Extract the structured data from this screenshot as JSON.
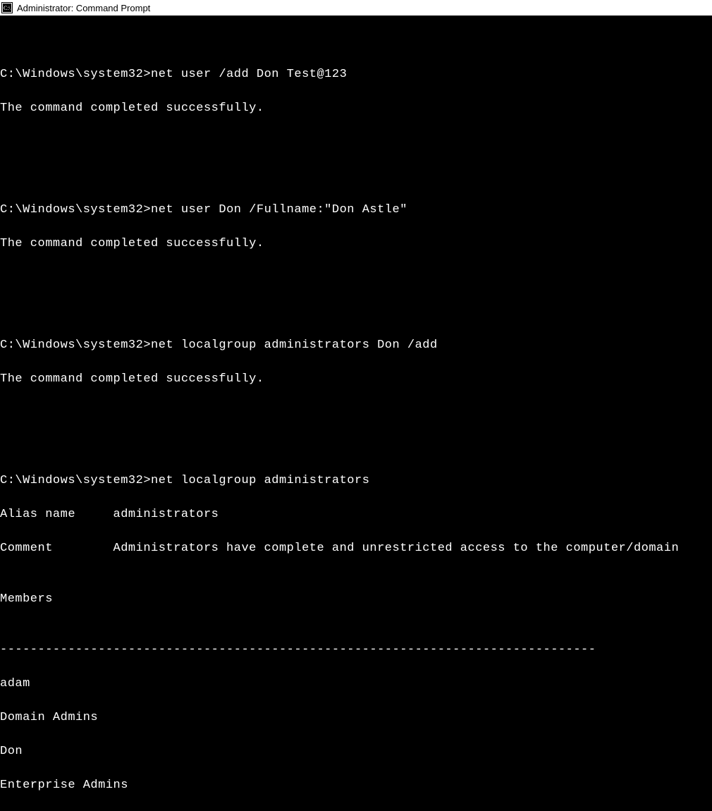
{
  "window": {
    "title": "Administrator: Command Prompt"
  },
  "prompt": "C:\\Windows\\system32>",
  "terminal": {
    "blocks": [
      {
        "cmd": "net user /add Don Test@123",
        "out": [
          "The command completed successfully."
        ]
      },
      {
        "cmd": "net user Don /Fullname:\"Don Astle\"",
        "out": [
          "The command completed successfully."
        ]
      },
      {
        "cmd": "net localgroup administrators Don /add",
        "out": [
          "The command completed successfully."
        ]
      },
      {
        "cmd": "net localgroup administrators",
        "out": [
          "Alias name     administrators",
          "Comment        Administrators have complete and unrestricted access to the computer/domain",
          "",
          "Members",
          "",
          "-------------------------------------------------------------------------------",
          "adam",
          "Domain Admins",
          "Don",
          "Enterprise Admins"
        ]
      }
    ]
  }
}
